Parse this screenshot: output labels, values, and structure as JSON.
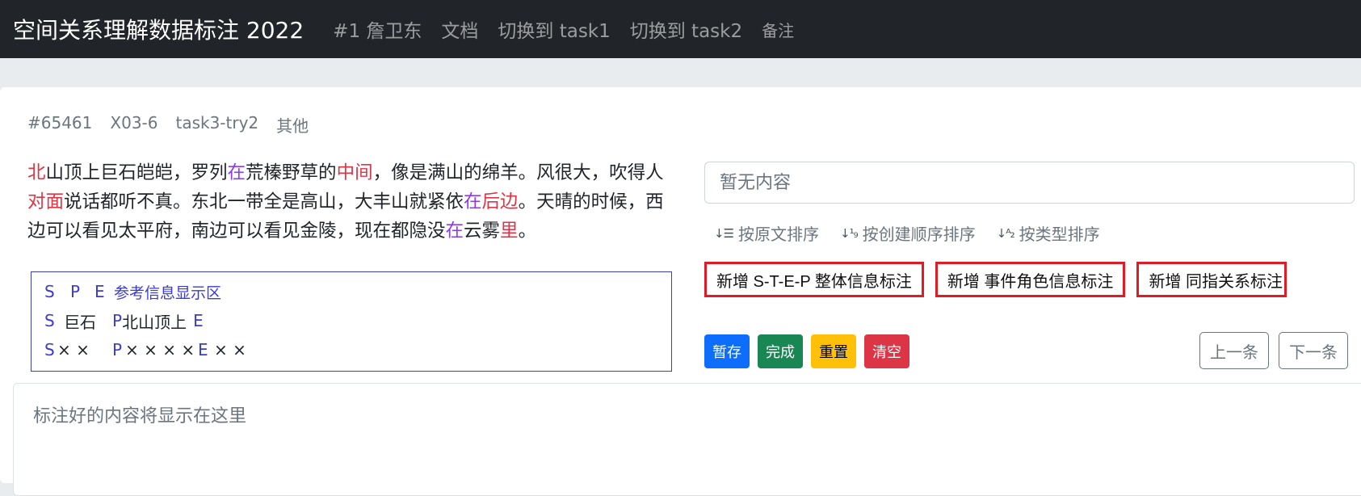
{
  "navbar": {
    "brand": "空间关系理解数据标注 2022",
    "links": [
      "#1 詹卫东",
      "文档",
      "切换到 task1",
      "切换到 task2",
      "备注"
    ]
  },
  "meta": {
    "id": "#65461",
    "code": "X03-6",
    "task": "task3-try2",
    "category": "其他"
  },
  "passage": {
    "segments": [
      {
        "text": "北",
        "color": "#dc3545"
      },
      {
        "text": "山顶上巨石皑皑，罗列"
      },
      {
        "text": "在",
        "color": "#8b3cf0"
      },
      {
        "text": "荒榛野草的"
      },
      {
        "text": "中间",
        "color": "#dc3545"
      },
      {
        "text": "，像是满山的绵羊。风很大，吹得人"
      },
      {
        "text": "对面",
        "color": "#dc3545"
      },
      {
        "text": "说话都听不真。东北一带全是高山，大丰山就紧依"
      },
      {
        "text": "在",
        "color": "#8b3cf0"
      },
      {
        "text": "后边",
        "color": "#dc3545"
      },
      {
        "text": "。天晴的时候，西边可以看见太平府，南边可以看见金陵，现在都隐没"
      },
      {
        "text": "在",
        "color": "#8b3cf0"
      },
      {
        "text": "云雾"
      },
      {
        "text": "里",
        "color": "#dc3545"
      },
      {
        "text": "。"
      }
    ]
  },
  "reference": {
    "header": {
      "s": "S",
      "p": "P",
      "e": "E",
      "title": "参考信息显示区"
    },
    "rows": [
      {
        "s": "S",
        "s_val": "巨石",
        "p": "P",
        "p_val": "北山顶上",
        "e": "E",
        "e_val": ""
      },
      {
        "s": "S",
        "s_val": "× ×",
        "p": "P",
        "p_val": "× × × ×",
        "e": "E",
        "e_val": "× ×"
      }
    ]
  },
  "search": {
    "placeholder": "暂无内容"
  },
  "sort": {
    "by_text": "按原文排序",
    "by_created": "按创建顺序排序",
    "by_type": "按类型排序"
  },
  "add_buttons": {
    "step": "新增 S-T-E-P 整体信息标注",
    "event_role": "新增 事件角色信息标注",
    "coref": "新增 同指关系标注"
  },
  "actions": {
    "save": "暂存",
    "done": "完成",
    "reset": "重置",
    "clear": "清空"
  },
  "pager": {
    "prev": "上一条",
    "next": "下一条"
  },
  "result": {
    "placeholder": "标注好的内容将显示在这里"
  },
  "colors": {
    "navbar_bg": "#212529",
    "highlight_red": "#dc3545",
    "highlight_purple": "#8b3cf0",
    "add_border": "#e01b24",
    "primary": "#0d6efd",
    "success": "#198754",
    "warning": "#ffc107",
    "danger": "#dc3545"
  }
}
